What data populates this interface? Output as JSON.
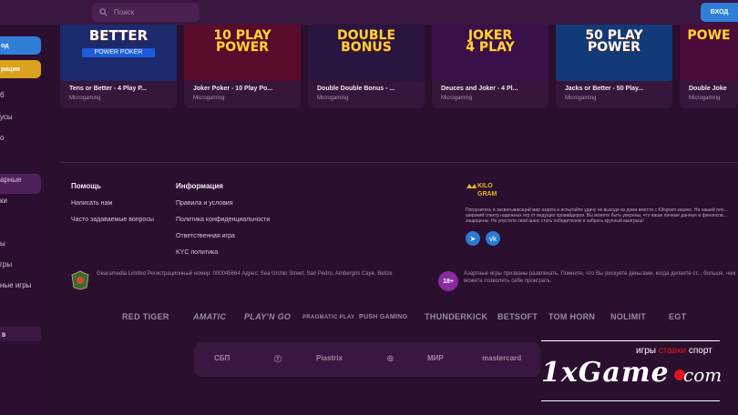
{
  "topbar": {
    "search_placeholder": "Поиск",
    "login_label": "ВХОД"
  },
  "sidebar": {
    "login_btn": "од",
    "register_btn": "рация",
    "items": [
      "б",
      "усы",
      "о",
      "арные",
      "ки",
      "ы",
      "гры",
      "ные игры"
    ],
    "select_value": "в"
  },
  "games": [
    {
      "art": "BETTER\nPOWER POKER",
      "title": "Tens or Better - 4 Play P...",
      "provider": "Microgaming",
      "color": "#1c2a6e"
    },
    {
      "art": "10 PLAY\nPOWER",
      "title": "Joker Poker - 10 Play Po...",
      "provider": "Microgaming",
      "color": "#5a0a2a"
    },
    {
      "art": "DOUBLE\nBONUS",
      "title": "Double Double Bonus - ...",
      "provider": "Microgaming",
      "color": "#2a1440"
    },
    {
      "art": "JOKER\n4 PLAY",
      "title": "Deuces and Joker - 4 Pl...",
      "provider": "Microgaming",
      "color": "#3a0f4a"
    },
    {
      "art": "50 PLAY\nPOWER",
      "title": "Jacks or Better - 50 Play...",
      "provider": "Microgaming",
      "color": "#123a78"
    },
    {
      "art": "POWE",
      "title": "Double Joke",
      "provider": "Microgaming",
      "color": "#4a0a3a"
    }
  ],
  "footer": {
    "help_heading": "Помощь",
    "help_links": [
      "Написать нам",
      "Часто задаваемые вопросы"
    ],
    "info_heading": "Информация",
    "info_links": [
      "Правила и условия",
      "Политика конфиденциальности",
      "Ответственная игра",
      "KYC политика"
    ],
    "logo_text": "KILO GRAM",
    "about": "Погрузитесь в захватывающий мир азарта и испытайте удачу не выходя из дома вместе с Kilogram казино. На нашей пло... широкий спектр надежных игр от ведущих провайдеров. Вы можете быть уверены, что ваши личные данные и финансов... защищены. Не упустите свой шанс стать победителем и забрать крупный выигрыш!",
    "license": "Gearamedia Limited Регистрационный номер: 000045664 Адрес: Sea Urchin Street, San Pedro, Ambergris Caye, Belize",
    "age_badge": "18+",
    "warning": "Азартные игры призваны развлекать. Помните, что Вы рискуете деньгами, когда делаете ст... больше, чем можете позволить себе проиграть."
  },
  "providers": [
    "RED TIGER",
    "AMATIC",
    "PLAY'N GO",
    "PRAGMATIC PLAY",
    "PUSH GAMING",
    "THUNDERKICK",
    "BETSOFT",
    "TOM HORN",
    "NOLIMIT",
    "EGT"
  ],
  "payments": [
    "СБП",
    "Piastrix",
    "МИР",
    "mastercard"
  ],
  "watermark": {
    "tag_plain": "игры ",
    "tag_red": "ставки",
    "tag_end": " спорт",
    "brand": "1xGame",
    "com": "com"
  },
  "colors": {
    "background": "#2a0f2e",
    "accent_blue": "#2f7fd8",
    "register_yellow": "#d9a21f",
    "badge_purple": "#8a2aa0"
  }
}
